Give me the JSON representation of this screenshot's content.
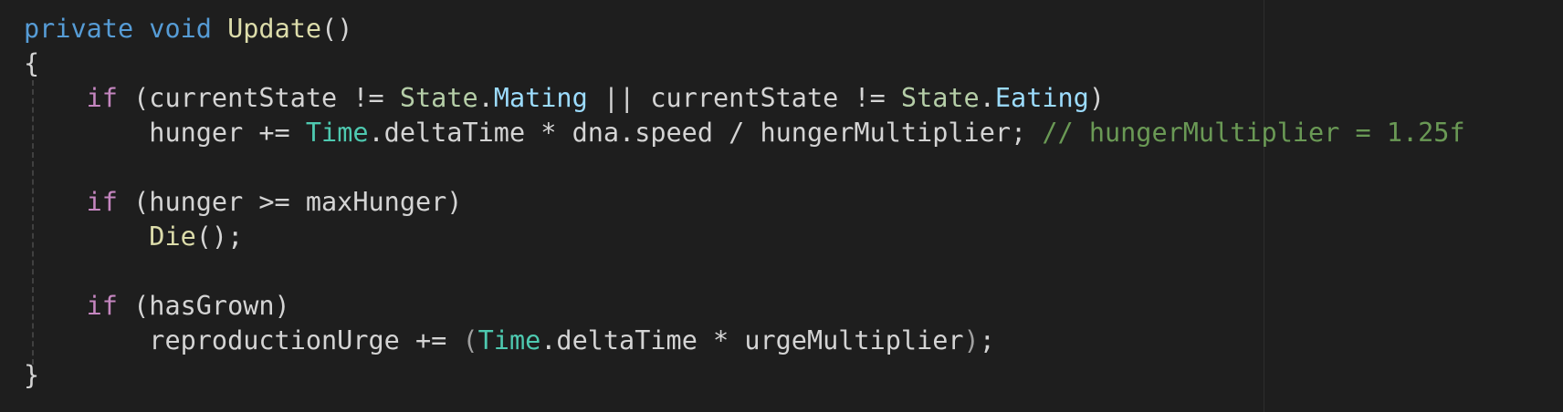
{
  "editor": {
    "theme_colors": {
      "background": "#1e1e1e",
      "keyword": "#569cd6",
      "control": "#c586c0",
      "function": "#dcdcaa",
      "type": "#4ec9b0",
      "enum_type": "#b5cea8",
      "property": "#9cdcfe",
      "comment": "#6a9955",
      "text": "#d4d4d4"
    },
    "lines": [
      {
        "indent": "",
        "tokens": [
          {
            "t": "private",
            "k": "kw"
          },
          {
            "t": " ",
            "k": "txt"
          },
          {
            "t": "void",
            "k": "kw"
          },
          {
            "t": " ",
            "k": "txt"
          },
          {
            "t": "Update",
            "k": "fn"
          },
          {
            "t": "()",
            "k": "txt"
          }
        ]
      },
      {
        "indent": "",
        "tokens": [
          {
            "t": "{",
            "k": "txt"
          }
        ]
      },
      {
        "indent": "    ",
        "tokens": [
          {
            "t": "if",
            "k": "ctl"
          },
          {
            "t": " (currentState != ",
            "k": "txt"
          },
          {
            "t": "State",
            "k": "enm"
          },
          {
            "t": ".",
            "k": "txt"
          },
          {
            "t": "Mating",
            "k": "prop"
          },
          {
            "t": " || currentState != ",
            "k": "txt"
          },
          {
            "t": "State",
            "k": "enm"
          },
          {
            "t": ".",
            "k": "txt"
          },
          {
            "t": "Eating",
            "k": "prop"
          },
          {
            "t": ")",
            "k": "txt"
          }
        ]
      },
      {
        "indent": "        ",
        "tokens": [
          {
            "t": "hunger += ",
            "k": "txt"
          },
          {
            "t": "Time",
            "k": "type"
          },
          {
            "t": ".deltaTime * dna.speed / hungerMultiplier; ",
            "k": "txt"
          },
          {
            "t": "// hungerMultiplier = 1.25f",
            "k": "cmt"
          }
        ]
      },
      {
        "indent": "",
        "tokens": []
      },
      {
        "indent": "    ",
        "tokens": [
          {
            "t": "if",
            "k": "ctl"
          },
          {
            "t": " (hunger >= maxHunger)",
            "k": "txt"
          }
        ]
      },
      {
        "indent": "        ",
        "tokens": [
          {
            "t": "Die",
            "k": "fn"
          },
          {
            "t": "();",
            "k": "txt"
          }
        ]
      },
      {
        "indent": "",
        "tokens": []
      },
      {
        "indent": "    ",
        "tokens": [
          {
            "t": "if",
            "k": "ctl"
          },
          {
            "t": " (hasGrown)",
            "k": "txt"
          }
        ]
      },
      {
        "indent": "        ",
        "tokens": [
          {
            "t": "reproductionUrge += ",
            "k": "txt"
          },
          {
            "t": "(",
            "k": "dim"
          },
          {
            "t": "Time",
            "k": "type"
          },
          {
            "t": ".deltaTime * urgeMultiplier",
            "k": "txt"
          },
          {
            "t": ")",
            "k": "dim"
          },
          {
            "t": ";",
            "k": "txt"
          }
        ]
      },
      {
        "indent": "",
        "tokens": [
          {
            "t": "}",
            "k": "txt"
          }
        ]
      }
    ]
  }
}
